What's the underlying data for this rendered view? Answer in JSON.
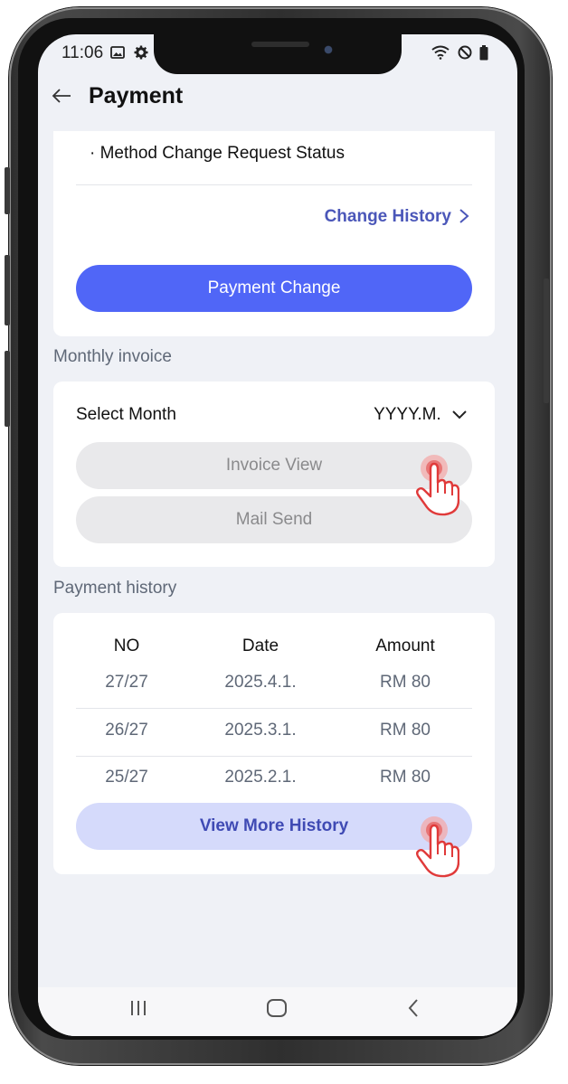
{
  "status_bar": {
    "time": "11:06",
    "left_icons": [
      "image-icon",
      "gear-icon"
    ],
    "right_icons": [
      "wifi-icon",
      "do-not-disturb-icon",
      "battery-icon"
    ]
  },
  "header": {
    "back_icon": "back-arrow-icon",
    "title": "Payment"
  },
  "method_card": {
    "bullet_text": "· Method Change Request Status",
    "change_history_label": "Change History",
    "payment_change_label": "Payment Change"
  },
  "monthly_invoice": {
    "section_title": "Monthly invoice",
    "select_month_label": "Select Month",
    "month_value": "YYYY.M.",
    "invoice_view_label": "Invoice View",
    "mail_send_label": "Mail Send"
  },
  "payment_history": {
    "section_title": "Payment history",
    "columns": [
      "NO",
      "Date",
      "Amount"
    ],
    "rows": [
      {
        "no": "27/27",
        "date": "2025.4.1.",
        "amount": "RM 80"
      },
      {
        "no": "26/27",
        "date": "2025.3.1.",
        "amount": "RM 80"
      },
      {
        "no": "25/27",
        "date": "2025.2.1.",
        "amount": "RM 80"
      }
    ],
    "view_more_label": "View More History"
  },
  "nav_bar": {
    "buttons": [
      "recent-apps-icon",
      "home-icon",
      "back-icon"
    ]
  },
  "colors": {
    "primary": "#5066f7",
    "link": "#4b57b9",
    "screen_bg": "#eff1f6",
    "tap_indicator": "#e03a3a"
  }
}
